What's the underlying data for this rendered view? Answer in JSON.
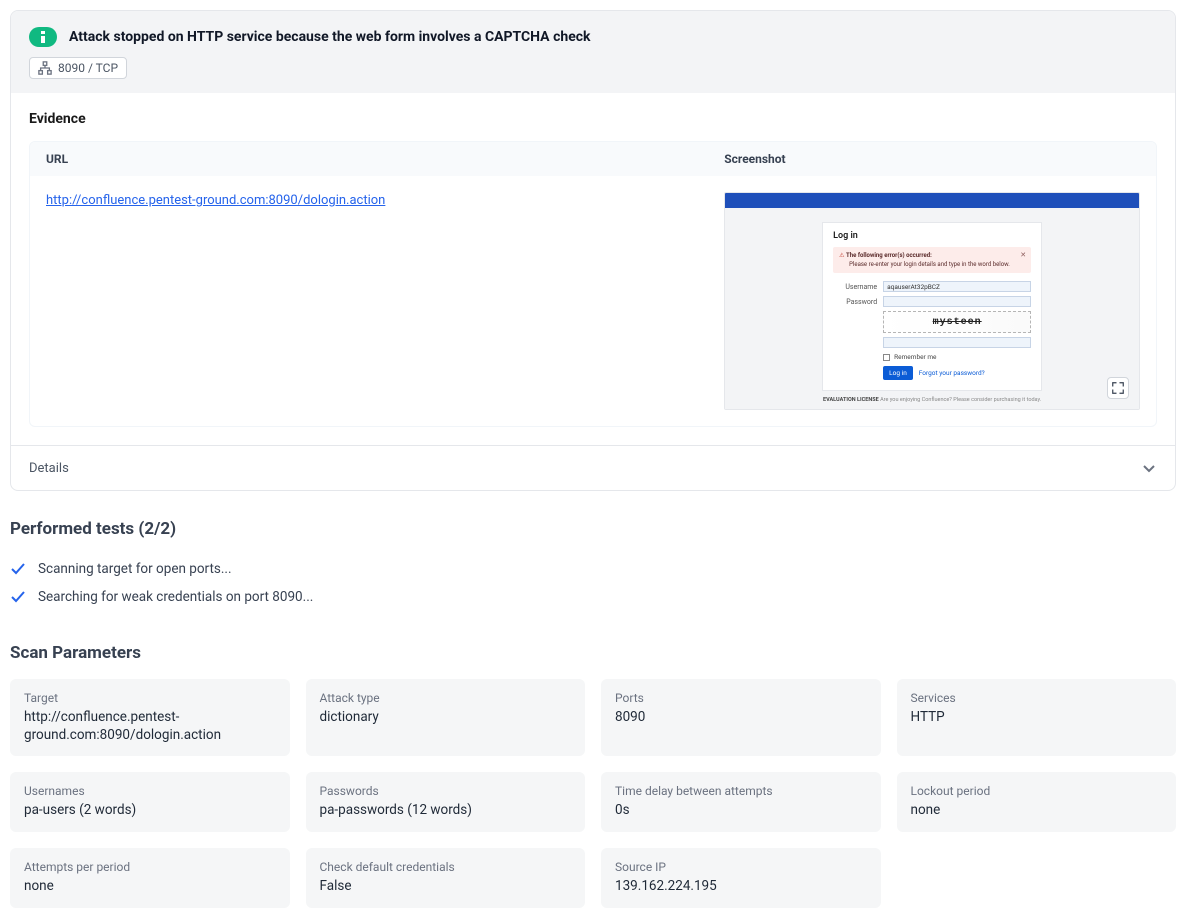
{
  "alert": {
    "title": "Attack stopped on HTTP service because the web form involves a CAPTCHA check",
    "port_chip": "8090 / TCP"
  },
  "evidence": {
    "heading": "Evidence",
    "columns": {
      "url": "URL",
      "screenshot": "Screenshot"
    },
    "row": {
      "url": "http://confluence.pentest-ground.com:8090/dologin.action"
    },
    "details_label": "Details"
  },
  "screenshot_mock": {
    "login_title": "Log in",
    "error_heading": "The following error(s) occurred:",
    "error_body": "Please re-enter your login details and type in the word below.",
    "username_label": "Username",
    "username_value": "aqauserAt32pBCZ",
    "password_label": "Password",
    "captcha_text": "mysteen",
    "remember": "Remember me",
    "login_btn": "Log in",
    "forgot": "Forgot your password?",
    "eval_bold": "EVALUATION LICENSE",
    "eval_rest": "Are you enjoying Confluence? Please consider purchasing it today."
  },
  "performed_tests": {
    "heading": "Performed tests (2/2)",
    "items": [
      "Scanning target for open ports...",
      "Searching for weak credentials on port 8090..."
    ]
  },
  "scan_params": {
    "heading": "Scan Parameters",
    "items": [
      {
        "label": "Target",
        "value": "http://confluence.pentest-ground.com:8090/dologin.action"
      },
      {
        "label": "Attack type",
        "value": "dictionary"
      },
      {
        "label": "Ports",
        "value": "8090"
      },
      {
        "label": "Services",
        "value": "HTTP"
      },
      {
        "label": "Usernames",
        "value": "pa-users (2 words)"
      },
      {
        "label": "Passwords",
        "value": "pa-passwords (12 words)"
      },
      {
        "label": "Time delay between attempts",
        "value": "0s"
      },
      {
        "label": "Lockout period",
        "value": "none"
      },
      {
        "label": "Attempts per period",
        "value": "none"
      },
      {
        "label": "Check default credentials",
        "value": "False"
      },
      {
        "label": "Source IP",
        "value": "139.162.224.195"
      }
    ]
  }
}
